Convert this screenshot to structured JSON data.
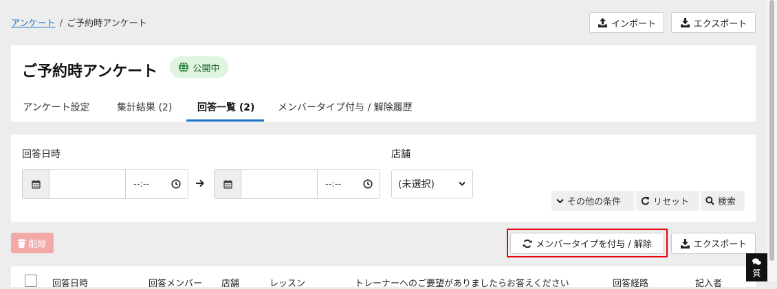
{
  "breadcrumb": {
    "root": "アンケート",
    "separator": "/",
    "current": "ご予約時アンケート"
  },
  "top_actions": {
    "import": "インポート",
    "export": "エクスポート"
  },
  "header": {
    "title": "ご予約時アンケート",
    "status_badge": "公開中",
    "tabs": [
      {
        "label": "アンケート設定"
      },
      {
        "label": "集計結果 (2)"
      },
      {
        "label": "回答一覧 (2)",
        "active": true
      },
      {
        "label": "メンバータイプ付与 / 解除履歴"
      }
    ]
  },
  "filters": {
    "answer_datetime_label": "回答日時",
    "from_time_placeholder": "--:--",
    "to_time_placeholder": "--:--",
    "store_label": "店舗",
    "store_value": "(未選択)",
    "more_conditions": "その他の条件",
    "reset": "リセット",
    "search": "検索"
  },
  "actions": {
    "delete": "削除",
    "member_type": "メンバータイプを付与 / 解除",
    "export": "エクスポート"
  },
  "table": {
    "columns": [
      "回答日時",
      "回答メンバー",
      "店舗",
      "レッスン",
      "トレーナーへのご要望がありましたらお答えください",
      "回答経路",
      "記入者"
    ]
  },
  "chat": {
    "label": "質"
  },
  "colors": {
    "accent": "#1a73c9",
    "highlight": "#e8000b",
    "badge_bg": "#dff5e0",
    "delete_bg": "#f4a9a9"
  }
}
